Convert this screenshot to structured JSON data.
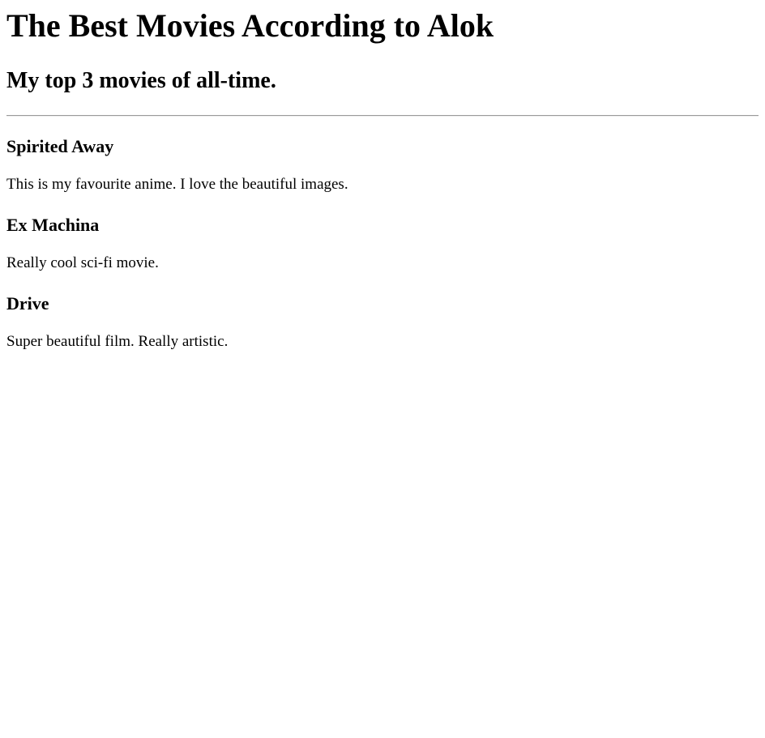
{
  "page": {
    "title": "The Best Movies According to Alok",
    "subtitle": "My top 3 movies of all-time."
  },
  "movies": [
    {
      "title": "Spirited Away",
      "description": "This is my favourite anime. I love the beautiful images."
    },
    {
      "title": "Ex Machina",
      "description": "Really cool sci-fi movie."
    },
    {
      "title": "Drive",
      "description": "Super beautiful film. Really artistic."
    }
  ]
}
